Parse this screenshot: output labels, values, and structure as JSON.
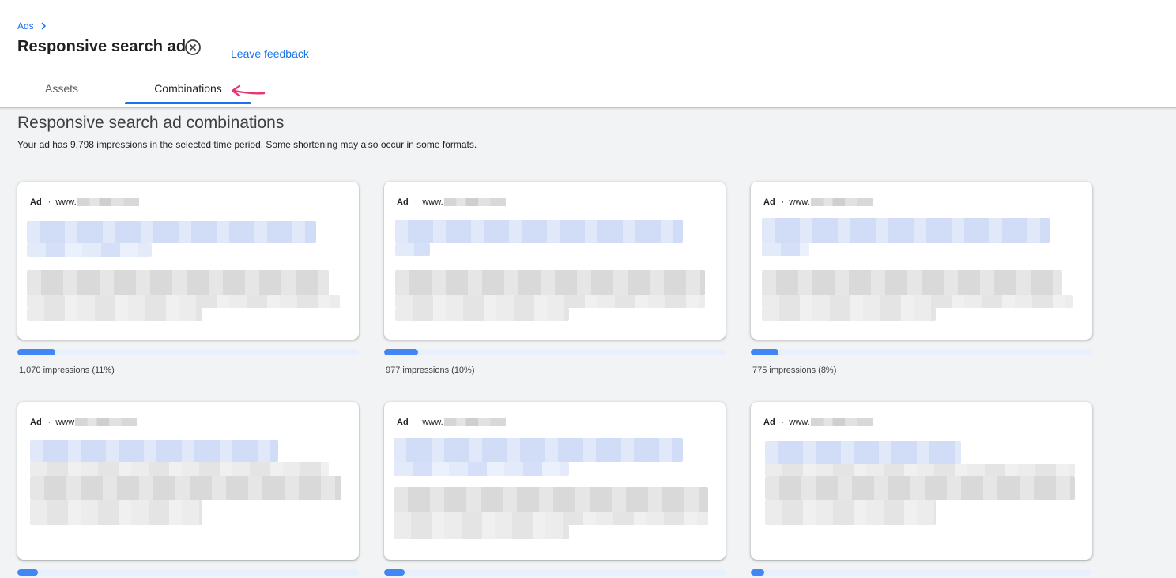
{
  "breadcrumb": {
    "parent": "Ads"
  },
  "title": "Responsive search ad",
  "feedback_label": "Leave feedback",
  "tabs": [
    {
      "label": "Assets",
      "active": false
    },
    {
      "label": "Combinations",
      "active": true
    }
  ],
  "section": {
    "title": "Responsive search ad combinations",
    "subtitle": "Your ad has 9,798 impressions in the selected time period. Some shortening may also occur in some formats."
  },
  "cards": [
    {
      "ad_label": "Ad",
      "url_prefix": "www.",
      "impressions": "1,070 impressions (11%)",
      "share": 0.11
    },
    {
      "ad_label": "Ad",
      "url_prefix": "www.",
      "impressions": "977 impressions (10%)",
      "share": 0.1
    },
    {
      "ad_label": "Ad",
      "url_prefix": "www.",
      "impressions": "775 impressions (8%)",
      "share": 0.08
    },
    {
      "ad_label": "Ad",
      "url_prefix": "www",
      "impressions": "",
      "share": 0.06
    },
    {
      "ad_label": "Ad",
      "url_prefix": "www.",
      "impressions": "",
      "share": 0.06
    },
    {
      "ad_label": "Ad",
      "url_prefix": "www.",
      "impressions": "",
      "share": 0.04
    }
  ],
  "colors": {
    "accent": "#1a73e8",
    "bar_fill": "#4285f4",
    "bar_track": "#e8f0fe",
    "annotation_arrow": "#e8336d"
  },
  "icons": {
    "breadcrumb": "chevron-right-icon",
    "close": "close-circle-icon",
    "annotation": "pink-arrow-icon"
  }
}
